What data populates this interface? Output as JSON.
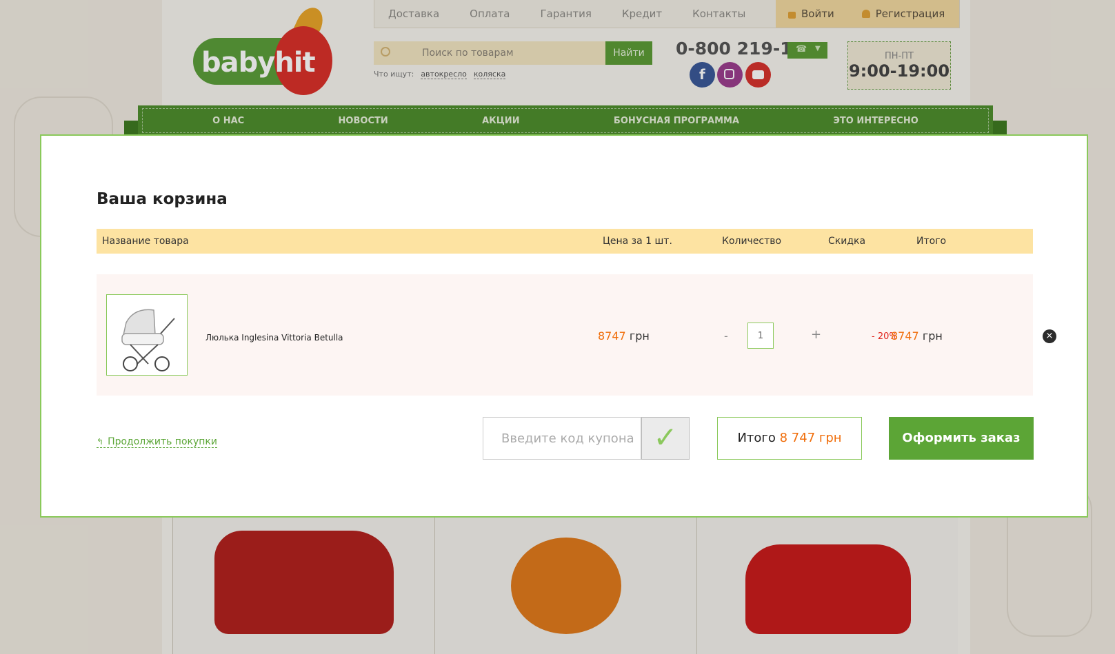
{
  "header": {
    "nav_links": [
      "Доставка",
      "Оплата",
      "Гарантия",
      "Кредит",
      "Контакты"
    ],
    "login_label": "Войти",
    "register_label": "Регистрация",
    "logo_text": "babyhit",
    "search": {
      "placeholder": "Поиск по товарам",
      "button_label": "Найти",
      "hints_label": "Что ищут:",
      "hints": [
        "автокресло",
        "коляска"
      ]
    },
    "phone": "0-800 219-114",
    "hours": {
      "days": "ПН-ПТ",
      "time": "9:00-19:00"
    }
  },
  "menu": {
    "items": [
      "О НАС",
      "НОВОСТИ",
      "АКЦИИ",
      "БОНУСНАЯ ПРОГРАММА",
      "ЭТО ИНТЕРЕСНО"
    ]
  },
  "cart": {
    "title": "Ваша корзина",
    "columns": {
      "name": "Название товара",
      "price": "Цена за 1 шт.",
      "qty": "Количество",
      "discount": "Скидка",
      "total": "Итого"
    },
    "items": [
      {
        "name": "Люлька Inglesina Vittoria Betulla",
        "price": "8747",
        "currency": "грн",
        "qty_minus": "-",
        "qty": "1",
        "qty_plus": "+",
        "discount": "- 20%",
        "total": "8747",
        "total_currency": "грн",
        "remove": "×"
      }
    ],
    "continue_label": "Продолжить покупки",
    "coupon_placeholder": "Введите код купона",
    "coupon_apply": "✓",
    "total_label": "Итого",
    "total_value": "8 747 грн",
    "order_label": "Оформить заказ"
  },
  "colors": {
    "accent_green": "#5ca536",
    "price_orange": "#f06d0a",
    "header_yellow": "#fde3a2",
    "discount_red": "#e0231b"
  }
}
